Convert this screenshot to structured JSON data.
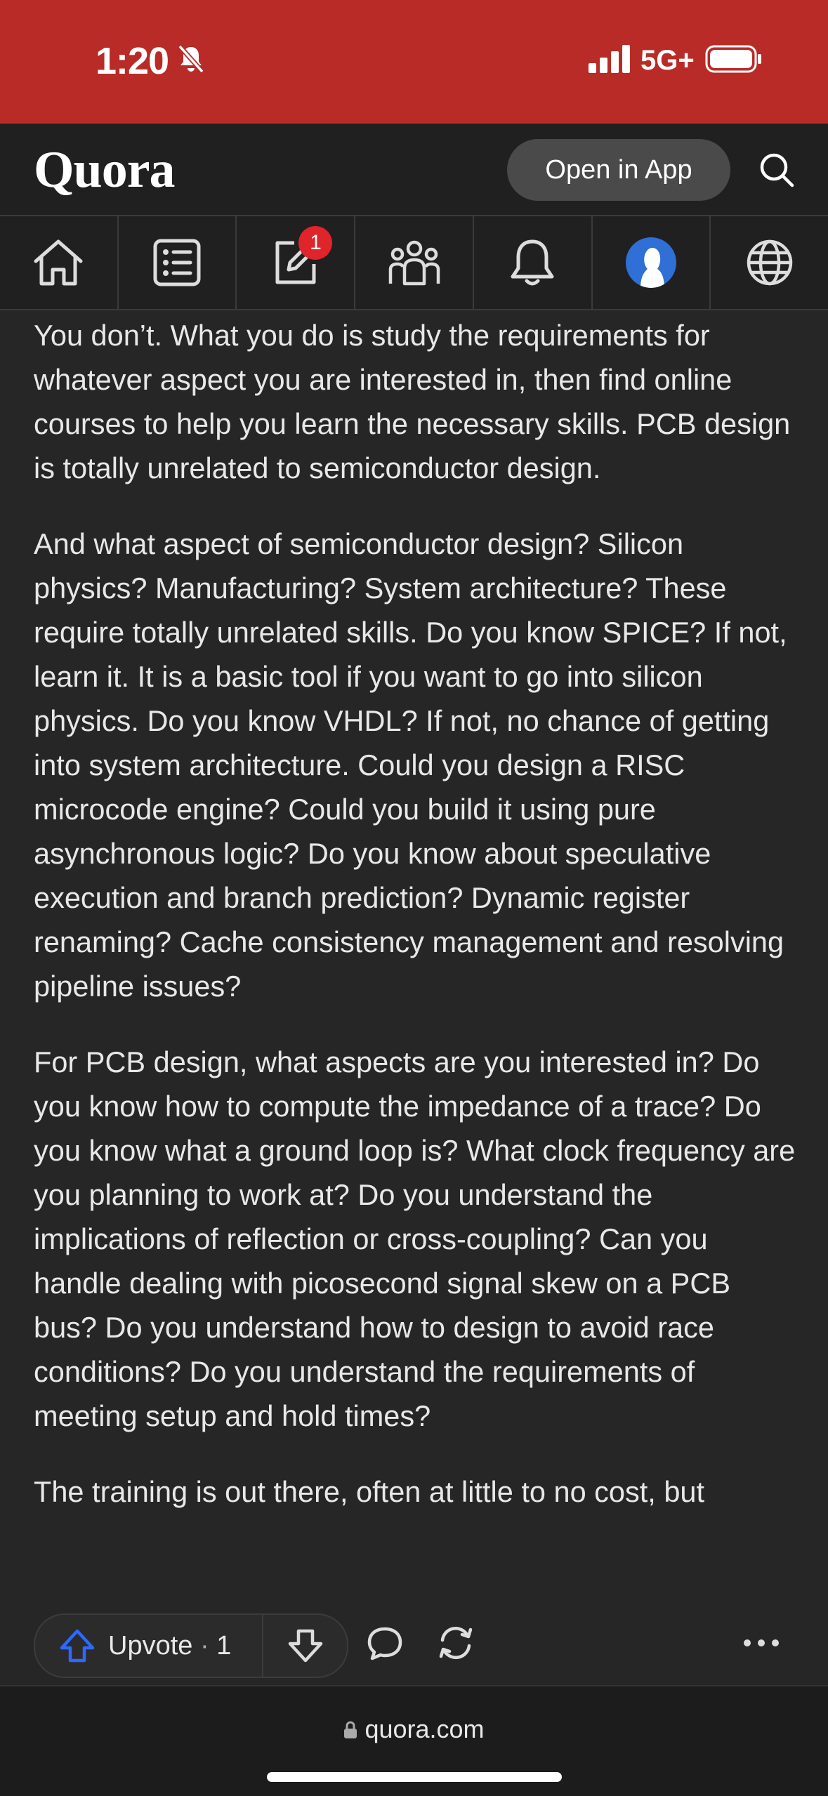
{
  "status_bar": {
    "time": "1:20",
    "network": "5G+",
    "bg_color": "#b92b27"
  },
  "header": {
    "logo": "Quora",
    "open_in_app_label": "Open in App"
  },
  "nav": {
    "items": [
      {
        "name": "home-icon"
      },
      {
        "name": "answers-list-icon"
      },
      {
        "name": "write-icon",
        "badge": "1"
      },
      {
        "name": "spaces-icon"
      },
      {
        "name": "notifications-bell-icon"
      },
      {
        "name": "profile-avatar"
      },
      {
        "name": "language-globe-icon"
      }
    ]
  },
  "answer": {
    "paragraphs": [
      "You don’t. What you do is study the requirements for whatever aspect you are interested in, then find online courses to help you learn the necessary skills. PCB design is totally unrelated to semiconductor design.",
      "And what aspect of semiconductor design? Silicon physics? Manufacturing? System architecture? These require totally unrelated skills. Do you know SPICE? If not, learn it. It is a basic tool if you want to go into silicon physics. Do you know VHDL? If not, no chance of getting into system architecture. Could you design a RISC microcode engine? Could you build it using pure asynchronous logic? Do you know about speculative execution and branch prediction? Dynamic register renaming? Cache consistency management and resolving pipeline issues?",
      "For PCB design, what aspects are you interested in? Do you know how to compute the impedance of a trace? Do you know what a ground loop is? What clock frequency are you planning to work at? Do you understand the implications of reflection or cross-coupling? Can you handle dealing with picosecond signal skew on a PCB bus? Do you understand how to design to avoid race conditions? Do you understand the requirements of meeting setup and hold times?",
      "The training is out there, often at little to no cost, but"
    ]
  },
  "actions": {
    "upvote_label": "Upvote",
    "separator": "·",
    "upvote_count": "1",
    "accent_color": "#2e69ff"
  },
  "browser": {
    "url": "quora.com"
  }
}
